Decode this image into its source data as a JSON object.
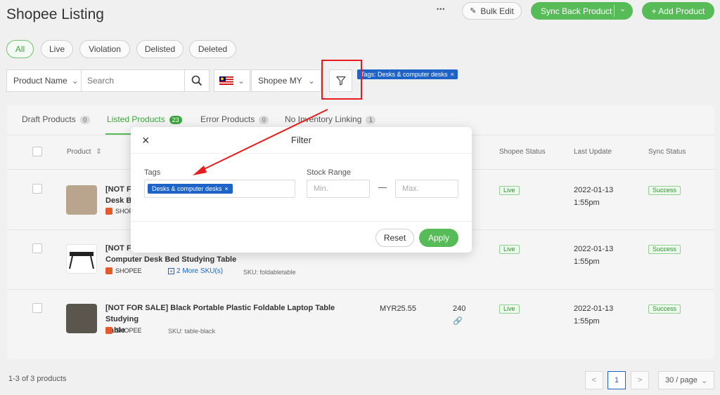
{
  "page": {
    "title": "Shopee Listing"
  },
  "toolbar": {
    "more_glyph": "•••",
    "bulk_edit_label": "Bulk Edit",
    "sync_back_label": "Sync Back Product",
    "add_product_label": "+ Add Product"
  },
  "status_pills": [
    {
      "label": "All"
    },
    {
      "label": "Live"
    },
    {
      "label": "Violation"
    },
    {
      "label": "Delisted"
    },
    {
      "label": "Deleted"
    }
  ],
  "search": {
    "field_select": "Product Name",
    "placeholder": "Search",
    "store_select": "Shopee MY",
    "active_tag": "Tags: Desks & computer desks"
  },
  "tabs": [
    {
      "label": "Draft Products",
      "count": "0"
    },
    {
      "label": "Listed Products",
      "count": "23"
    },
    {
      "label": "Error Products",
      "count": "0"
    },
    {
      "label": "No Inventory Linking",
      "count": "1"
    }
  ],
  "table": {
    "headers": {
      "product": "Product",
      "shopee_status": "Shopee Status",
      "last_update": "Last Update",
      "sync_status": "Sync Status"
    },
    "rows": [
      {
        "name_line1": "[NOT FOR",
        "name_line2": "Desk Be",
        "store": "SHOPE",
        "status": "Live",
        "date": "2022-01-13",
        "time": "1:55pm",
        "sync": "Success"
      },
      {
        "name_line1": "[NOT FO",
        "name_line2": "Computer Desk Bed Studying Table",
        "store": "SHOPEE",
        "more_sku": "2 More SKU(s)",
        "sku": "SKU: foldabletable",
        "status": "Live",
        "date": "2022-01-13",
        "time": "1:55pm",
        "sync": "Success"
      },
      {
        "name_line1": "[NOT FOR SALE] Black Portable Plastic Foldable Laptop Table Studying",
        "name_line2": "Table",
        "store": "SHOPEE",
        "sku": "SKU: table-black",
        "price": "MYR25.55",
        "stock": "240",
        "status": "Live",
        "date": "2022-01-13",
        "time": "1:55pm",
        "sync": "Success"
      }
    ]
  },
  "footer": {
    "count_text": "1-3 of 3 products",
    "prev": "<",
    "page": "1",
    "next": ">",
    "page_size": "30 / page"
  },
  "modal": {
    "title": "Filter",
    "tags_label": "Tags",
    "tag_chip": "Desks & computer desks",
    "stock_label": "Stock Range",
    "min_placeholder": "Min.",
    "max_placeholder": "Max.",
    "reset_label": "Reset",
    "apply_label": "Apply"
  },
  "colors": {
    "brand_green": "#57bb57",
    "chip_blue": "#1e63c8",
    "annotation_red": "#e81c1c"
  }
}
